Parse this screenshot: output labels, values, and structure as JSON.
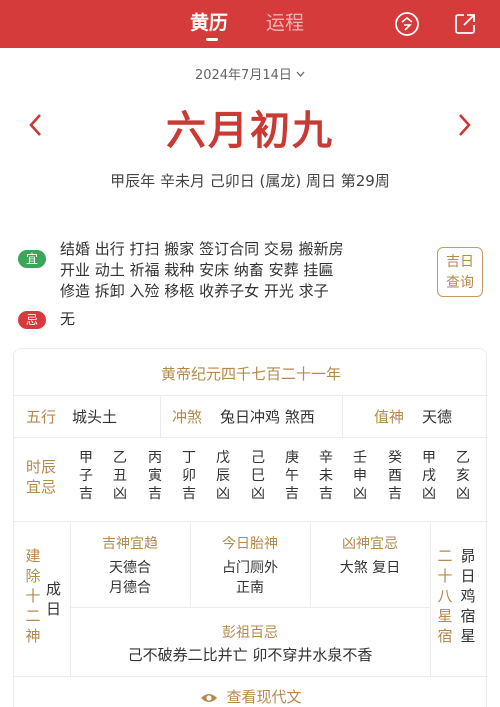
{
  "tabs": {
    "active": "黄历",
    "inactive": "运程"
  },
  "top_icons": {
    "today": "calendar-today-icon",
    "share": "share-icon"
  },
  "date": {
    "solar": "2024年7月14日",
    "dropdown_icon": "chevron-down-icon",
    "lunar": "六月初九",
    "ganzhi": "甲辰年 辛未月 己卯日 (属龙) 周日  第29周"
  },
  "yi": {
    "badge": "宜",
    "lines": [
      "结婚 出行 打扫 搬家 签订合同 交易 搬新房",
      "开业 动土 祈福 栽种 安床 纳畜 安葬 挂匾",
      "修造 拆卸 入殓 移柩 收养子女 开光 求子"
    ]
  },
  "ji": {
    "badge": "忌",
    "text": "无"
  },
  "jiri_button": {
    "line1": "吉日",
    "line2": "查询"
  },
  "card": {
    "era": "黄帝纪元四千七百二十一年",
    "wuxing_label": "五行",
    "wuxing_value": "城头土",
    "chongsha_label": "冲煞",
    "chongsha_value": "兔日冲鸡 煞西",
    "zhishen_label": "值神",
    "zhishen_value": "天德",
    "shichen_label": [
      "时辰",
      "宜忌"
    ],
    "shichen": [
      [
        "甲",
        "子",
        "吉"
      ],
      [
        "乙",
        "丑",
        "凶"
      ],
      [
        "丙",
        "寅",
        "吉"
      ],
      [
        "丁",
        "卯",
        "吉"
      ],
      [
        "戊",
        "辰",
        "凶"
      ],
      [
        "己",
        "巳",
        "凶"
      ],
      [
        "庚",
        "午",
        "吉"
      ],
      [
        "辛",
        "未",
        "吉"
      ],
      [
        "壬",
        "申",
        "凶"
      ],
      [
        "癸",
        "酉",
        "吉"
      ],
      [
        "甲",
        "戌",
        "凶"
      ],
      [
        "乙",
        "亥",
        "凶"
      ]
    ],
    "jianchu_label": [
      "建",
      "除",
      "十",
      "二",
      "神"
    ],
    "jianchu_value": "成日",
    "jishen_title": "吉神宜趋",
    "jishen_lines": [
      "天德合",
      "月德合"
    ],
    "taishen_title": "今日胎神",
    "taishen_lines": [
      "占门厕外",
      "正南"
    ],
    "xiongshen_title": "凶神宜忌",
    "xiongshen_lines": [
      "大煞 复日"
    ],
    "pengzu_title": "彭祖百忌",
    "pengzu_text": "己不破券二比并亡 卯不穿井水泉不香",
    "xiu_label": [
      "二",
      "十",
      "八",
      "星",
      "宿"
    ],
    "xiu_value": [
      "昴",
      "日",
      "鸡",
      "宿",
      "星"
    ],
    "view_modern": "查看现代文"
  },
  "colors": {
    "primary_red": "#d63b3b",
    "gold": "#b5894d",
    "yi_green": "#3aa657"
  }
}
